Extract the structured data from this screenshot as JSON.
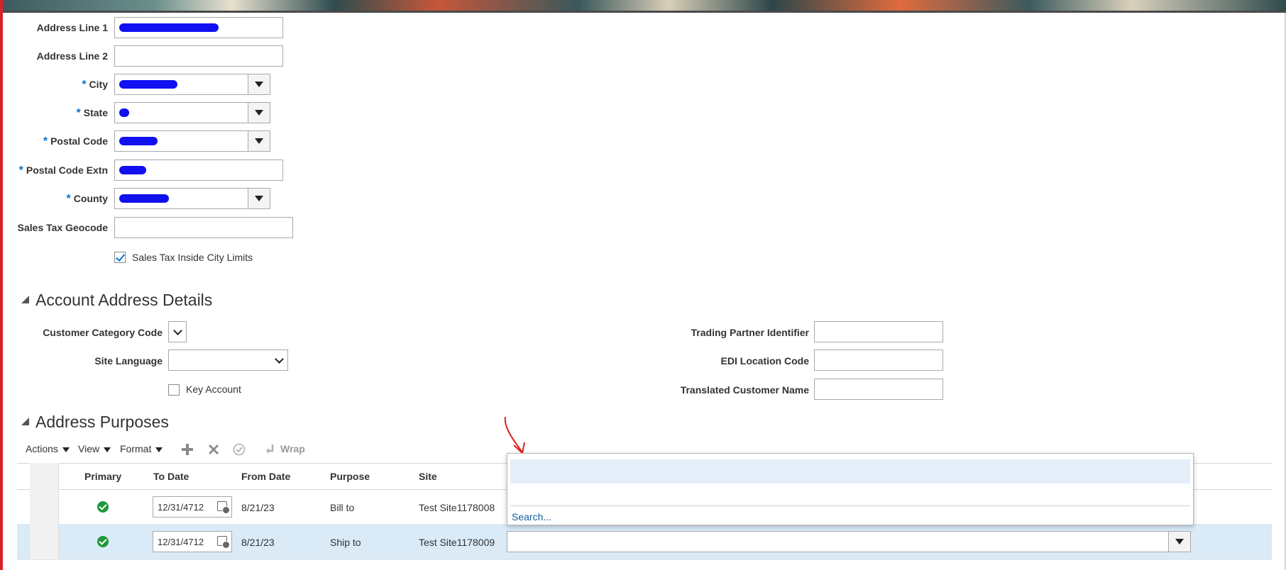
{
  "form": {
    "address_line1_label": "Address Line 1",
    "address_line2_label": "Address Line 2",
    "city_label": "City",
    "state_label": "State",
    "postal_code_label": "Postal Code",
    "postal_code_extn_label": "Postal Code Extn",
    "county_label": "County",
    "sales_tax_geocode_label": "Sales Tax Geocode",
    "sales_tax_inside_city_limits_label": "Sales Tax Inside City Limits",
    "sales_tax_inside_city_limits_checked": true,
    "required_marker": "*"
  },
  "account_address_details": {
    "title": "Account Address Details",
    "customer_category_code_label": "Customer Category Code",
    "site_language_label": "Site Language",
    "key_account_label": "Key Account",
    "key_account_checked": false,
    "trading_partner_identifier_label": "Trading Partner Identifier",
    "edi_location_code_label": "EDI Location Code",
    "translated_customer_name_label": "Translated Customer Name"
  },
  "address_purposes": {
    "title": "Address Purposes",
    "toolbar": {
      "actions_label": "Actions",
      "view_label": "View",
      "format_label": "Format",
      "wrap_label": "Wrap"
    },
    "columns": [
      "Primary",
      "To Date",
      "From Date",
      "Purpose",
      "Site"
    ],
    "rows": [
      {
        "to_date": "12/31/4712",
        "from_date": "8/21/23",
        "purpose": "Bill to",
        "site": "Test Site1178008"
      },
      {
        "to_date": "12/31/4712",
        "from_date": "8/21/23",
        "purpose": "Ship to",
        "site": "Test Site1178009"
      }
    ],
    "dropdown": {
      "search_label": "Search..."
    }
  },
  "colors": {
    "accent": "#0572ce",
    "selected_row": "#daeaf7",
    "success": "#1d9a3a",
    "annotation": "#e0201e"
  }
}
